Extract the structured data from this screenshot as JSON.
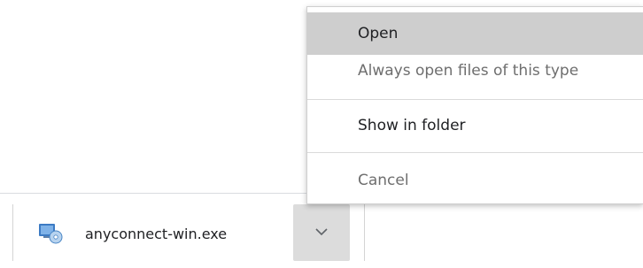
{
  "download_shelf": {
    "file_name": "anyconnect-win.exe",
    "file_icon": "installer-exe-icon",
    "dropdown_icon": "chevron-down-icon"
  },
  "context_menu": {
    "items": [
      {
        "label": "Open",
        "state": "highlighted"
      },
      {
        "label": "Always open files of this type",
        "state": "enabled"
      },
      {
        "label": "Show in folder",
        "state": "enabled"
      },
      {
        "label": "Cancel",
        "state": "enabled"
      }
    ]
  },
  "colors": {
    "highlight": "#cecece",
    "dropdown_button_bg": "#dcdcdc",
    "text": "#202124",
    "muted_text": "#6e6e6e"
  }
}
